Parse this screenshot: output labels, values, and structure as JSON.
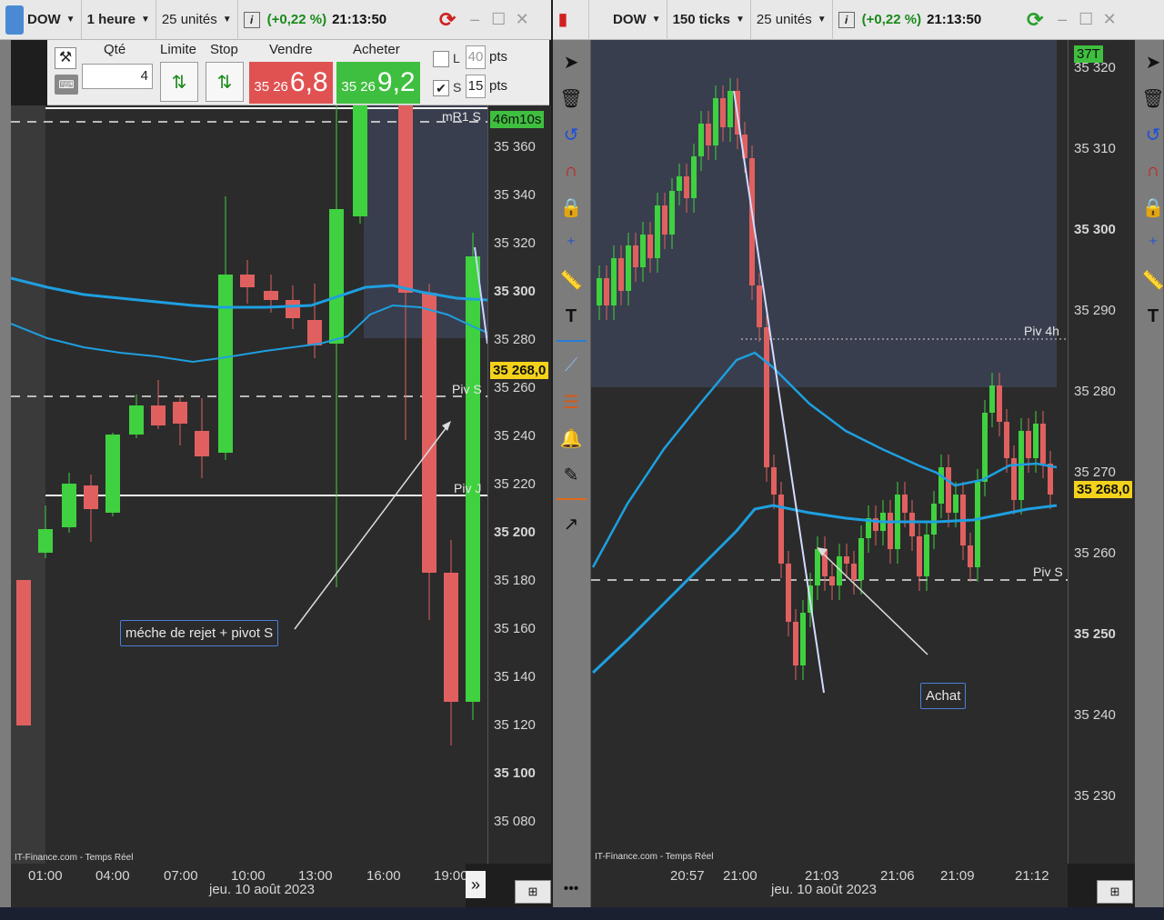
{
  "left": {
    "symbol": "DOW",
    "period": "1 heure",
    "units": "25 unités",
    "change": "(+0,22 %)",
    "time": "21:13:50",
    "order": {
      "qty_label": "Qté",
      "qty_value": "4",
      "limit_label": "Limite",
      "stop_label": "Stop",
      "sell_label": "Vendre",
      "buy_label": "Acheter",
      "sell_small": "35 26",
      "sell_big": "6,8",
      "buy_small": "35 26",
      "buy_big": "9,2",
      "l_label": "L",
      "l_value": "40",
      "s_label": "S",
      "s_value": "15",
      "pts_label": "pts"
    },
    "price_ticks": [
      "35 360",
      "35 340",
      "35 320",
      "35 300",
      "35 280",
      "35 260",
      "35 240",
      "35 220",
      "35 200",
      "35 180",
      "35 160",
      "35 140",
      "35 120",
      "35 100",
      "35 080"
    ],
    "time_ticks": [
      "01:00",
      "04:00",
      "07:00",
      "10:00",
      "13:00",
      "16:00",
      "19:00"
    ],
    "date": "jeu. 10 août 2023",
    "labels": {
      "mr1s": "mR1 S",
      "pivs": "Piv S",
      "pivj": "Piv J"
    },
    "countdown": "46m10s",
    "last_price": "35 268,0",
    "annotation": "méche de rejet + pivot S",
    "source": "IT-Finance.com - Temps Réel"
  },
  "right": {
    "symbol": "DOW",
    "period": "150 ticks",
    "units": "25 unités",
    "change": "(+0,22 %)",
    "time": "21:13:50",
    "price_ticks": [
      "35 320",
      "35 310",
      "35 300",
      "35 290",
      "35 280",
      "35 270",
      "35 260",
      "35 250",
      "35 240",
      "35 230"
    ],
    "time_ticks": [
      "20:57",
      "21:00",
      "21:03",
      "21:06",
      "21:09",
      "21:12"
    ],
    "date": "jeu. 10 août 2023",
    "labels": {
      "piv4h": "Piv 4h",
      "pivs": "Piv S"
    },
    "tick_count": "37T",
    "last_price": "35 268,0",
    "annotation": "Achat",
    "source": "IT-Finance.com - Temps Réel"
  },
  "colors": {
    "up": "#3fd13f",
    "down": "#e06060",
    "ma": "#1e9fe0",
    "bg": "#2b2b2b"
  }
}
